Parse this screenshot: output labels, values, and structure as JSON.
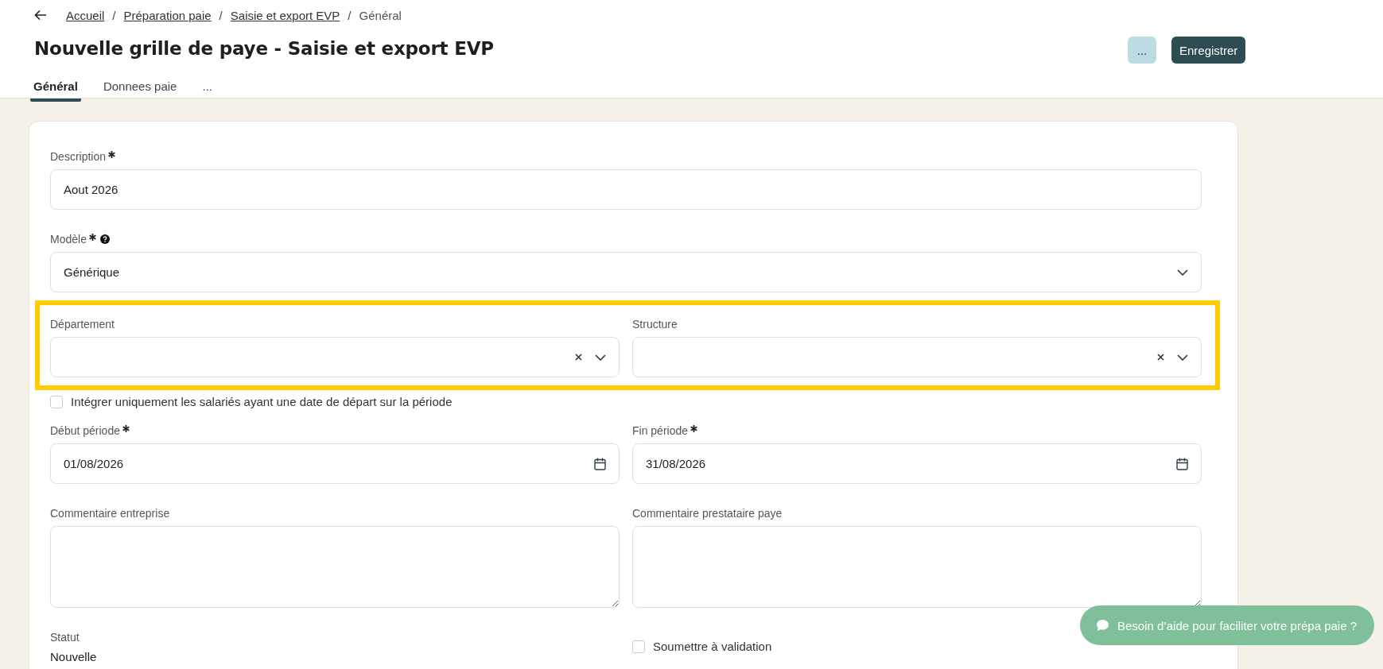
{
  "breadcrumb": [
    {
      "label": "Accueil",
      "link": true,
      "separator": "/"
    },
    {
      "label": "Préparation paie",
      "link": true,
      "separator": "/"
    },
    {
      "label": "Saisie et export EVP",
      "link": true,
      "separator": "/"
    },
    {
      "label": "Général",
      "link": false
    }
  ],
  "title": "Nouvelle grille de paye - Saisie et export EVP",
  "actions": [
    {
      "label": "...",
      "kind": "secondary"
    },
    {
      "label": "Enregistrer",
      "kind": "primary"
    }
  ],
  "tabs": [
    {
      "label": "Général",
      "selected": true
    },
    {
      "label": "Donnees paie",
      "selected": false
    },
    {
      "label": "...",
      "selected": false
    }
  ],
  "form": {
    "rows": [
      {
        "highlighted": false,
        "fields": [
          {
            "kind": "text",
            "label": "Description",
            "required": true,
            "value": "Aout 2026"
          }
        ]
      },
      {
        "highlighted": false,
        "fields": [
          {
            "kind": "select",
            "label": "Modèle",
            "required": true,
            "help": true,
            "value": "Générique"
          }
        ]
      },
      {
        "highlighted": true,
        "fields": [
          {
            "kind": "select",
            "label": "Département",
            "required": false,
            "clearable": true
          },
          {
            "kind": "select",
            "label": "Structure",
            "required": false,
            "clearable": true
          }
        ]
      },
      {
        "highlighted": false,
        "fields": [
          {
            "kind": "checkbox",
            "label": "Intégrer uniquement les salariés ayant une date de départ sur la période",
            "checked": false
          }
        ]
      },
      {
        "highlighted": false,
        "fields": [
          {
            "kind": "date",
            "label": "Début période",
            "required": true,
            "value": "01/08/2026"
          },
          {
            "kind": "date",
            "label": "Fin période",
            "required": true,
            "value": "31/08/2026"
          }
        ]
      },
      {
        "highlighted": false,
        "fields": [
          {
            "kind": "textarea",
            "label": "Commentaire entreprise",
            "required": false
          },
          {
            "kind": "textarea",
            "label": "Commentaire prestataire paye",
            "required": false
          }
        ]
      },
      {
        "highlighted": false,
        "fields": [
          {
            "kind": "status",
            "label": "Statut",
            "value": "Nouvelle"
          },
          {
            "kind": "checkbox",
            "label": "Soumettre à validation",
            "checked": false
          }
        ]
      }
    ]
  },
  "chat": {
    "label": "Besoin d’aide pour faciliter votre prépa paie ?"
  }
}
